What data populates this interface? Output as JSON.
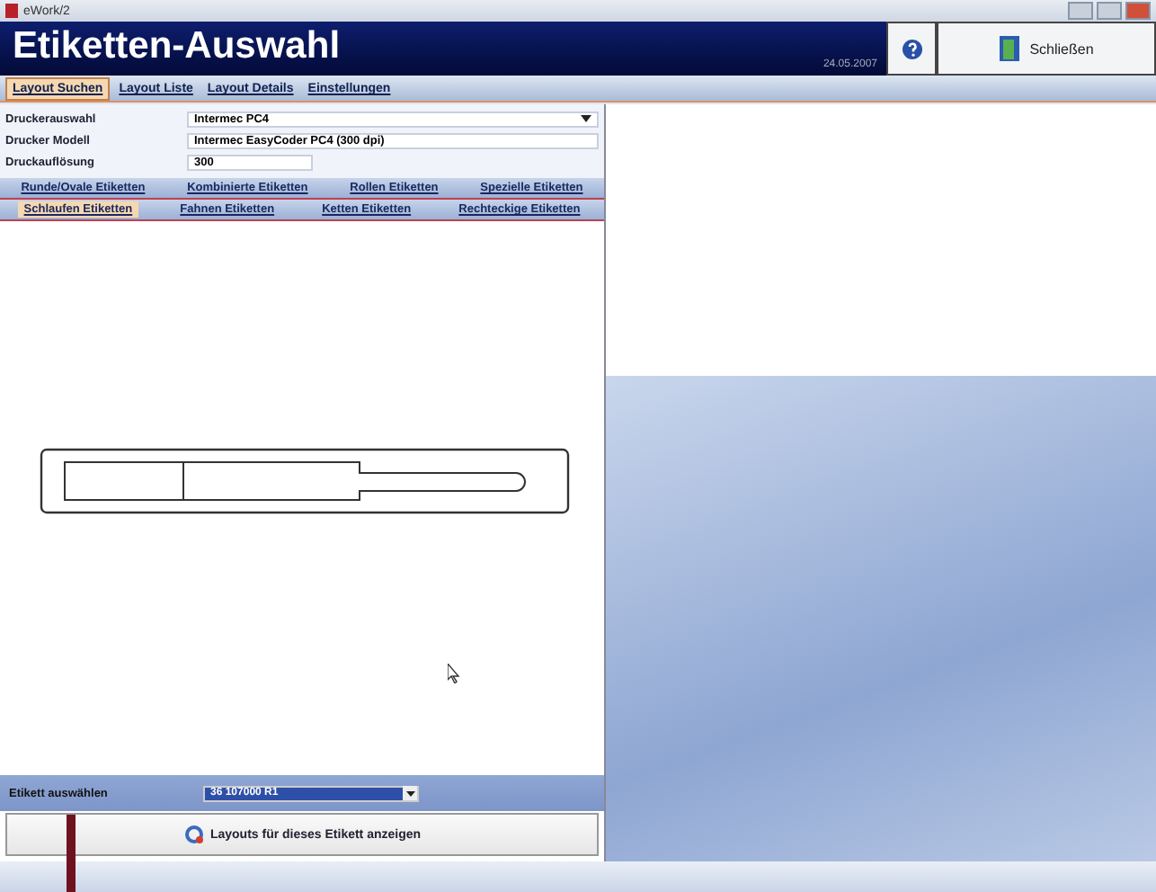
{
  "window": {
    "title": "eWork/2"
  },
  "header": {
    "title": "Etiketten-Auswahl",
    "date": "24.05.2007",
    "close_button": "Schließen"
  },
  "tabs": [
    {
      "label": "Layout Suchen",
      "selected": true
    },
    {
      "label": "Layout Liste",
      "selected": false
    },
    {
      "label": "Layout Details",
      "selected": false
    },
    {
      "label": "Einstellungen",
      "selected": false
    }
  ],
  "fields": [
    {
      "label": "Druckerauswahl",
      "value": "Intermec PC4",
      "kind": "dropdown"
    },
    {
      "label": "Drucker Modell",
      "value": "Intermec EasyCoder PC4 (300 dpi)",
      "kind": "text"
    },
    {
      "label": "Druckauflösung",
      "value": "300",
      "kind": "short"
    }
  ],
  "label_tabs_row1": [
    {
      "label": "Runde/Ovale Etiketten",
      "selected": false
    },
    {
      "label": "Kombinierte Etiketten",
      "selected": false
    },
    {
      "label": "Rollen Etiketten",
      "selected": false
    },
    {
      "label": "Spezielle Etiketten",
      "selected": false
    }
  ],
  "label_tabs_row2": [
    {
      "label": "Schlaufen Etiketten",
      "selected": true
    },
    {
      "label": "Fahnen Etiketten",
      "selected": false
    },
    {
      "label": "Ketten Etiketten",
      "selected": false
    },
    {
      "label": "Rechteckige Etiketten",
      "selected": false
    }
  ],
  "select": {
    "label": "Etikett auswählen",
    "value": "36 107000 R1"
  },
  "show_button": "Layouts für dieses Etikett anzeigen"
}
